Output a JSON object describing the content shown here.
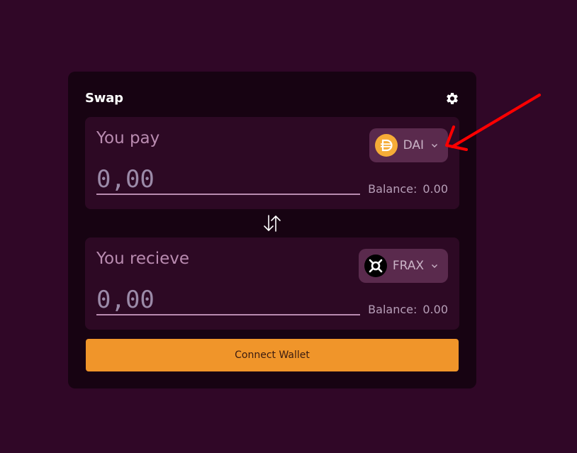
{
  "swap": {
    "title": "Swap",
    "pay": {
      "label": "You pay",
      "placeholder": "0,00",
      "balance_label": "Balance:",
      "balance_value": "0.00",
      "token": {
        "symbol": "DAI",
        "icon": "dai-icon"
      }
    },
    "receive": {
      "label": "You recieve",
      "placeholder": "0,00",
      "balance_label": "Balance:",
      "balance_value": "0.00",
      "token": {
        "symbol": "FRAX",
        "icon": "frax-icon"
      }
    },
    "connect_label": "Connect Wallet"
  },
  "colors": {
    "background": "#300727",
    "card": "#170312",
    "panel": "#2d0924",
    "token_button": "#5a2a4d",
    "accent": "#f0952a",
    "annotation": "#ff0000"
  }
}
